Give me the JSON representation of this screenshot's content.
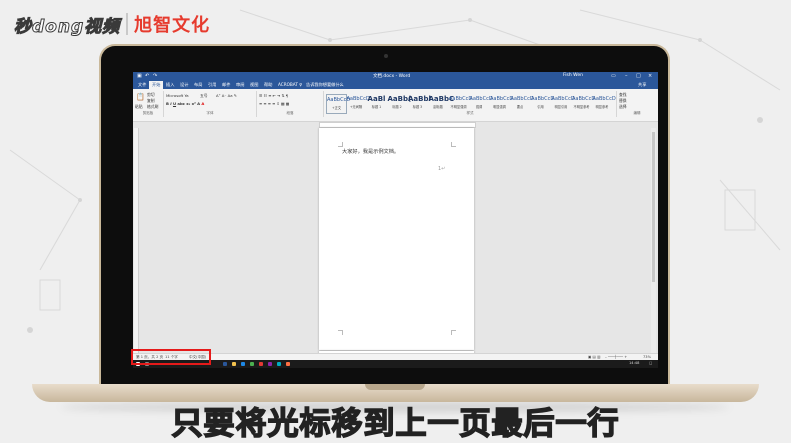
{
  "watermark": {
    "brand_left": "秒dong视频",
    "brand_right": "旭智文化"
  },
  "word": {
    "title": "文档.docx - Word",
    "user": "Fish Wen",
    "tabs": [
      "文件",
      "开始",
      "插入",
      "设计",
      "布局",
      "引用",
      "邮件",
      "审阅",
      "视图",
      "帮助",
      "ACROBAT",
      "告诉我你想要做什么"
    ],
    "active_tab": 1,
    "share": "共享",
    "ribbon": {
      "clipboard": {
        "label": "剪贴板",
        "paste": "粘贴",
        "cut": "剪切",
        "copy": "复制",
        "painter": "格式刷"
      },
      "font": {
        "label": "字体",
        "name": "Microsoft Ya",
        "size": "五号"
      },
      "paragraph": {
        "label": "段落"
      },
      "styles": {
        "label": "样式",
        "items": [
          {
            "sample": "AaBbCcD",
            "name": "+正文"
          },
          {
            "sample": "AaBbCcD",
            "name": "+无间隔"
          },
          {
            "sample": "AaBl",
            "name": "标题 1"
          },
          {
            "sample": "AaBb(",
            "name": "标题 2"
          },
          {
            "sample": "AaBbl",
            "name": "标题 3"
          },
          {
            "sample": "AaBbC",
            "name": "副标题"
          },
          {
            "sample": "AaBbCcD",
            "name": "不明显强调"
          },
          {
            "sample": "AaBbCcD",
            "name": "强调"
          },
          {
            "sample": "AaBbCcD",
            "name": "明显强调"
          },
          {
            "sample": "AaBbCcD",
            "name": "要点"
          },
          {
            "sample": "AaBbCcD",
            "name": "引用"
          },
          {
            "sample": "AaBbCcD",
            "name": "明显引用"
          },
          {
            "sample": "AaBbCcD",
            "name": "不明显参考"
          },
          {
            "sample": "AaBbCcD",
            "name": "明显参考"
          }
        ]
      },
      "editing": {
        "find": "查找",
        "replace": "替换",
        "select": "选择",
        "label": "编辑"
      }
    },
    "document": {
      "text": "大家好，我是示例文档。",
      "page_mark": "1↵"
    },
    "statusbar": {
      "page": "第 1 页，共 2 页",
      "words": "11 个字",
      "lang": "中文(中国)",
      "zoom": "73%"
    },
    "taskbar": {
      "time": "14:48"
    }
  },
  "subtitle": "只要将光标移到上一页最后一行",
  "colors": {
    "word_blue": "#2b579a",
    "highlight_red": "#e51a1a"
  }
}
